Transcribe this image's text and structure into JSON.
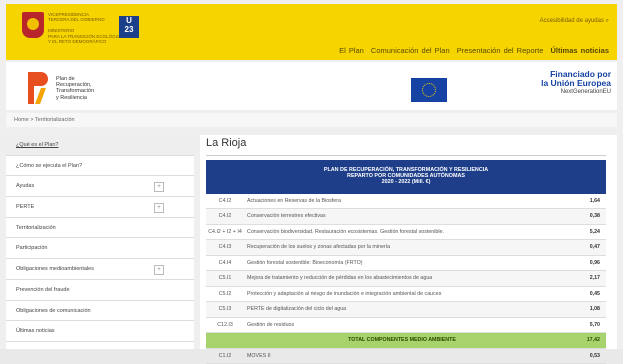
{
  "header": {
    "gov_text": "VICEPRESIDENCIA\nTERCERA DEL GOBIERNO\n\nMINISTERIO\nPARA LA TRANSICIÓN ECOLÓGICA\nY EL RETO DEMOGRÁFICO",
    "eu23_label": "U\n23",
    "search_label": "Accesibilidad de ayudas",
    "nav": [
      "El Plan",
      "Comunicación del Plan",
      "Presentación del Reporte",
      "Últimas noticias"
    ]
  },
  "brand": {
    "prtr_text": "Plan de\nRecuperación,\nTransformación\ny Resiliencia",
    "eu_line1": "Financiado por",
    "eu_line2": "la Unión Europea",
    "eu_line3": "NextGenerationEU"
  },
  "breadcrumb": "Home  >  Territorialización",
  "sidebar": {
    "items": [
      {
        "label": "¿Qué es el Plan?",
        "plus": false,
        "active": true
      },
      {
        "label": "¿Cómo se ejecuta el Plan?",
        "plus": false,
        "active": false
      },
      {
        "label": "Ayudas",
        "plus": true,
        "active": false
      },
      {
        "label": "PERTE",
        "plus": true,
        "active": false
      },
      {
        "label": "Territorialización",
        "plus": false,
        "active": false
      },
      {
        "label": "Participación",
        "plus": false,
        "active": false
      },
      {
        "label": "Obligaciones medioambientales",
        "plus": true,
        "active": false
      },
      {
        "label": "Prevención del fraude",
        "plus": false,
        "active": false
      },
      {
        "label": "Obligaciones de comunicación",
        "plus": false,
        "active": false
      },
      {
        "label": "Últimas noticias",
        "plus": false,
        "active": false
      }
    ],
    "plus_symbol": "+"
  },
  "main": {
    "region": "La Rioja",
    "table_title_1": "PLAN DE RECUPERACIÓN, TRANSFORMACIÓN Y RESILIENCIA",
    "table_title_2": "REPARTO POR COMUNIDADES AUTÓNOMAS",
    "table_title_3": "2020 - 2022 (Mill. €)",
    "rows": [
      {
        "code": "C4.I2",
        "desc": "Actuaciones en Reservas de la Biosfera",
        "value": "1,64"
      },
      {
        "code": "C4.I2",
        "desc": "Conservación terrestres efectivas",
        "value": "0,38"
      },
      {
        "code": "C4.I2 + I2 + I4",
        "desc": "Conservación biodiversidad. Restauración ecosistemas. Gestión forestal sostenible.",
        "value": "5,24"
      },
      {
        "code": "C4.I3",
        "desc": "Recuperación de los suelos y zonas afectadas por la minería",
        "value": "0,47"
      },
      {
        "code": "C4.I4",
        "desc": "Gestión forestal sostenible: Bioeconomía (FRTO)",
        "value": "0,96"
      },
      {
        "code": "C5.I1",
        "desc": "Mejora de tratamiento y reducción de pérdidas en los abastecimientos de agua",
        "value": "2,17"
      },
      {
        "code": "C5.I2",
        "desc": "Protección y adaptación al riesgo de inundación e integración ambiental de cauces",
        "value": "0,45"
      },
      {
        "code": "C5.I3",
        "desc": "PERTE de digitalización del ciclo del agua",
        "value": "1,08"
      },
      {
        "code": "C12.I3",
        "desc": "Gestión de residuos",
        "value": "5,70"
      }
    ],
    "total_label": "TOTAL COMPONENTES MEDIO AMBIENTE",
    "total_value": "17,42",
    "last_row": {
      "code": "C1.I2",
      "desc": "MOVES II",
      "value": "0,53"
    }
  }
}
